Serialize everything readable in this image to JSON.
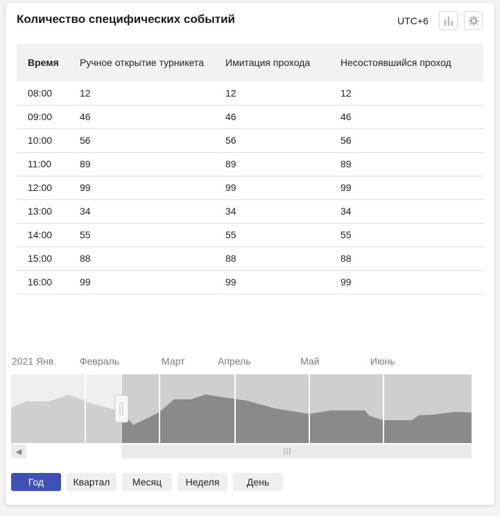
{
  "header": {
    "title": "Количество специфических событий",
    "timezone": "UTC+6",
    "chart_button_icon": "bar-chart-icon",
    "settings_button_icon": "gear-icon"
  },
  "table": {
    "columns": [
      "Время",
      "Ручное открытие турникета",
      "Имитация прохода",
      "Несостоявшийся проход"
    ],
    "rows": [
      [
        "08:00",
        "12",
        "12",
        "12"
      ],
      [
        "09:00",
        "46",
        "46",
        "46"
      ],
      [
        "10:00",
        "56",
        "56",
        "56"
      ],
      [
        "11:00",
        "89",
        "89",
        "89"
      ],
      [
        "12:00",
        "99",
        "99",
        "99"
      ],
      [
        "13:00",
        "34",
        "34",
        "34"
      ],
      [
        "14:00",
        "55",
        "55",
        "55"
      ],
      [
        "15:00",
        "88",
        "88",
        "88"
      ],
      [
        "16:00",
        "99",
        "99",
        "99"
      ]
    ]
  },
  "navigator": {
    "months": [
      "2021 Янв",
      "Февраль",
      "Март",
      "Апрель",
      "Май",
      "Июнь"
    ],
    "colors": {
      "background": "#cfcfcf",
      "area": "#8a8a8a",
      "unselected_bg": "#efefef",
      "unselected_area": "#cfcfcf"
    }
  },
  "periods": {
    "items": [
      "Год",
      "Квартал",
      "Месяц",
      "Неделя",
      "День"
    ],
    "active": "Год",
    "accent": "#3f51b5"
  }
}
